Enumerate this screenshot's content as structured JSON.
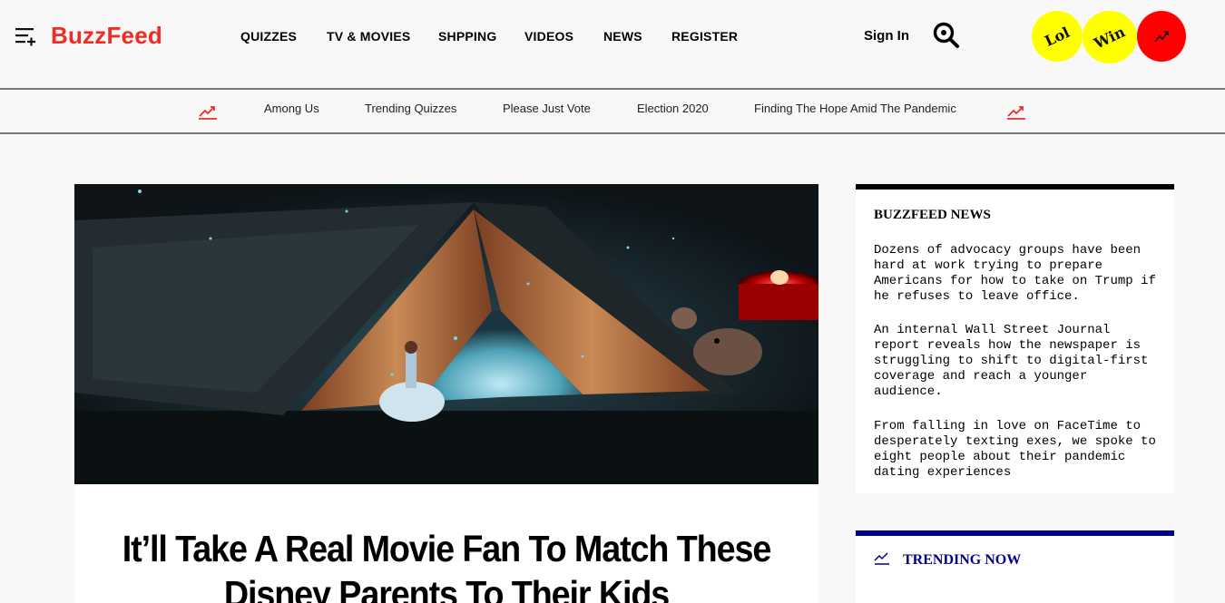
{
  "header": {
    "logo": "BuzzFeed",
    "nav": [
      "QUIZZES",
      "TV & MOVIES",
      "SHPPING",
      "VIDEOS",
      "NEWS",
      "REGISTER"
    ],
    "sign_in": "Sign In",
    "badges": [
      "Lol",
      "Win"
    ],
    "icons": [
      "menu-plus-icon",
      "search-icon",
      "trending-icon"
    ]
  },
  "trending_bar": {
    "links": [
      "Among Us",
      "Trending Quizzes",
      "Please Just Vote",
      "Election 2020",
      "Finding The Hope Amid The Pandemic"
    ]
  },
  "article": {
    "headline": "It’ll Take A Real Movie Fan To Match These Disney Parents To Their Kids"
  },
  "sidebar": {
    "news_title": "BUZZFEED NEWS",
    "news_items": [
      "Dozens of advocacy groups have been hard at work trying to prepare Americans for how to take on Trump if he refuses to leave office.",
      "An internal Wall Street Journal report reveals how the newspaper is struggling to shift to digital-first coverage and reach a younger audience.",
      "From falling in love on FaceTime to desperately texting exes, we spoke to eight people about their pandemic dating experiences"
    ],
    "trending_title": "TRENDING NOW"
  },
  "colors": {
    "brand": "#ee2d24",
    "badge_yellow": "#ffff00",
    "badge_red": "#ff0000",
    "trending_blue": "#00008b"
  }
}
